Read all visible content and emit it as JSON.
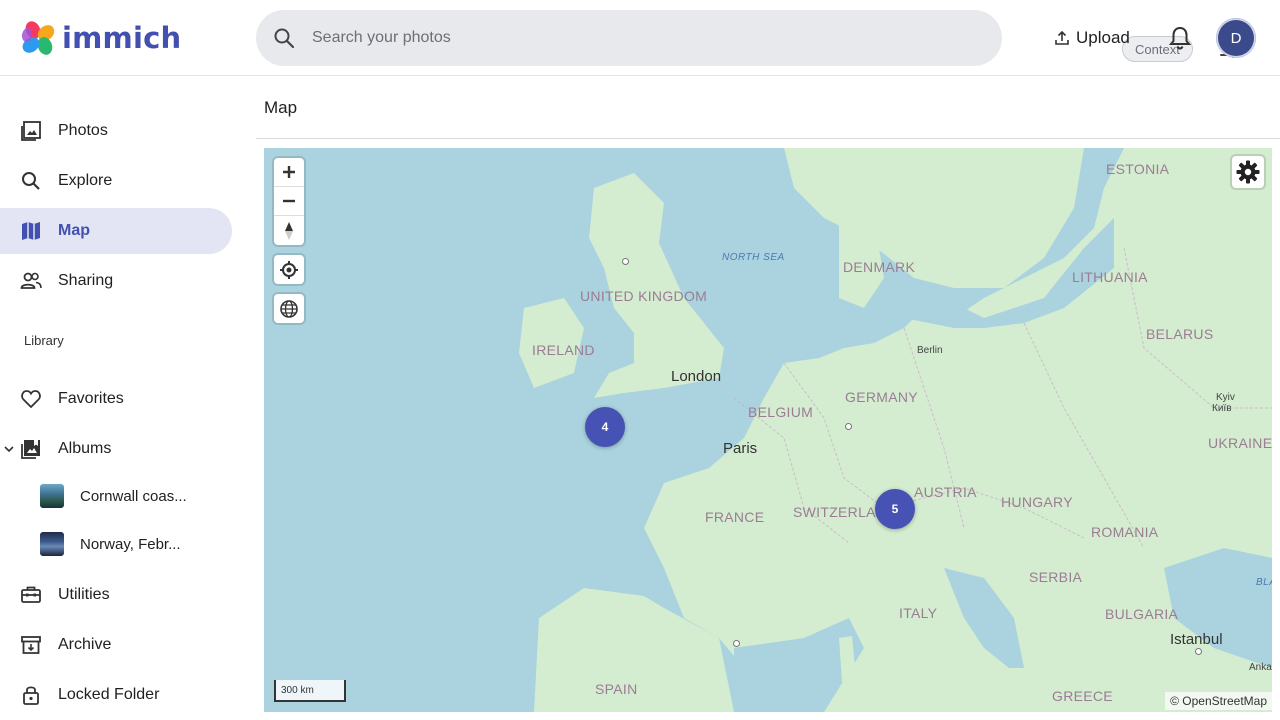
{
  "app": {
    "name": "immich"
  },
  "header": {
    "search_placeholder": "Search your photos",
    "context_chip": "Context",
    "upload_label": "Upload",
    "avatar_initial": "D",
    "icons": [
      "search-icon",
      "tune-icon",
      "upload-icon",
      "bell-icon"
    ]
  },
  "sidebar": {
    "items": [
      {
        "label": "Photos",
        "icon": "photos-icon"
      },
      {
        "label": "Explore",
        "icon": "search-icon"
      },
      {
        "label": "Map",
        "icon": "map-icon",
        "active": true
      },
      {
        "label": "Sharing",
        "icon": "people-icon"
      }
    ],
    "library_label": "Library",
    "library_items": [
      {
        "label": "Favorites",
        "icon": "heart-icon"
      },
      {
        "label": "Albums",
        "icon": "album-icon"
      }
    ],
    "albums": [
      {
        "label": "Cornwall coas..."
      },
      {
        "label": "Norway, Febr..."
      }
    ],
    "other_items": [
      {
        "label": "Utilities",
        "icon": "toolbox-icon"
      },
      {
        "label": "Archive",
        "icon": "archive-icon"
      },
      {
        "label": "Locked Folder",
        "icon": "lock-icon"
      }
    ]
  },
  "main": {
    "title": "Map",
    "map": {
      "clusters": [
        {
          "count": "4"
        },
        {
          "count": "5"
        }
      ],
      "scale_label": "300 km",
      "attribution": "© OpenStreetMap",
      "countries": [
        "ESTONIA",
        "DENMARK",
        "LITHUANIA",
        "UNITED KINGDOM",
        "BELARUS",
        "IRELAND",
        "BELGIUM",
        "GERMANY",
        "UKRAINE",
        "AUSTRIA",
        "HUNGARY",
        "FRANCE",
        "SWITZERLAND",
        "ROMANIA",
        "SERBIA",
        "ITALY",
        "BULGARIA",
        "SPAIN",
        "GREECE"
      ],
      "cities": [
        "London",
        "Paris",
        "Istanbul"
      ],
      "small_labels": [
        "Berlin",
        "Kyiv",
        "Київ",
        "Anka",
        "BLA"
      ],
      "sea_labels": [
        "NORTH SEA"
      ],
      "colors": {
        "water": "#aad3df",
        "land": "#d4ecd0",
        "cluster": "#4652b4",
        "accent": "#4250af"
      }
    }
  }
}
